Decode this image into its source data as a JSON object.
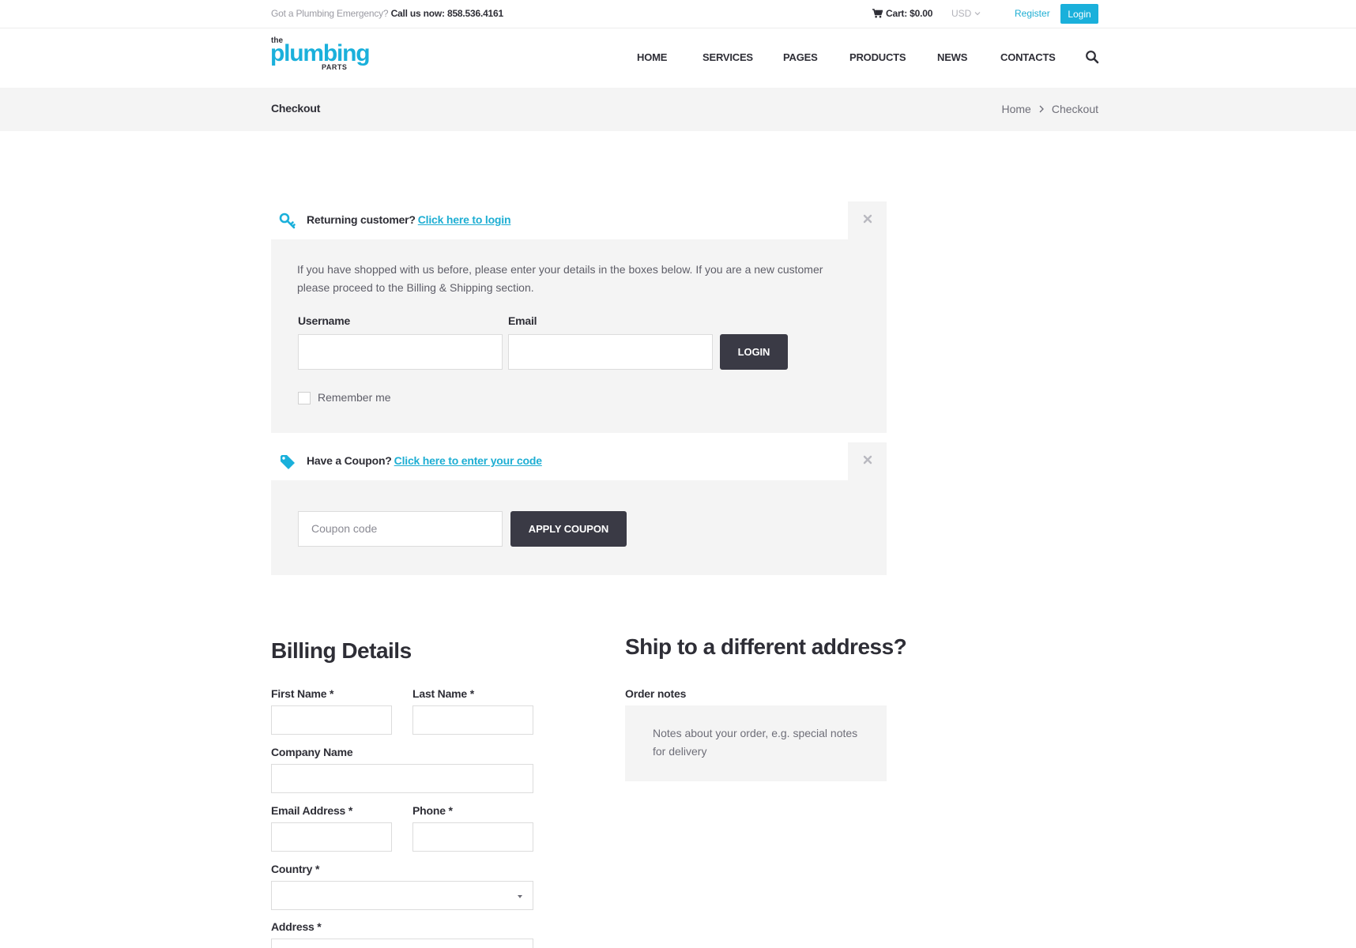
{
  "topbar": {
    "emergency_text": "Got a Plumbing Emergency?",
    "call_text": "Call us now: 858.536.4161",
    "cart_label": "Cart: $0.00",
    "currency": "USD",
    "register_label": "Register",
    "login_label": "Login"
  },
  "logo": {
    "the": "the",
    "main": "plumbing",
    "sub": "PARTS"
  },
  "nav": {
    "items": [
      "HOME",
      "SERVICES",
      "PAGES",
      "PRODUCTS",
      "NEWS",
      "CONTACTS"
    ]
  },
  "band": {
    "title": "Checkout",
    "breadcrumb": [
      "Home",
      "Checkout"
    ]
  },
  "returning": {
    "prompt": "Returning customer?",
    "link": "Click here to login",
    "description": "If you have shopped with us before, please enter your details in the boxes below. If you are a new customer please proceed to the Billing & Shipping section.",
    "username_label": "Username",
    "email_label": "Email",
    "login_button": "LOGIN",
    "remember_label": "Remember me"
  },
  "coupon": {
    "prompt": "Have a Coupon?",
    "link": "Click here to enter your code",
    "placeholder": "Coupon code",
    "apply_button": "APPLY COUPON"
  },
  "billing": {
    "title": "Billing Details",
    "first_name": "First Name *",
    "last_name": "Last Name *",
    "company": "Company Name",
    "email": "Email Address *",
    "phone": "Phone *",
    "country": "Country *",
    "address": "Address *"
  },
  "shipping": {
    "title": "Ship to a different address?",
    "notes_label": "Order notes",
    "notes_placeholder": "Notes about your order, e.g. special notes for delivery"
  },
  "colors": {
    "accent": "#1ab0db",
    "dark_button": "#3a3a45",
    "panel_bg": "#f4f4f4"
  }
}
